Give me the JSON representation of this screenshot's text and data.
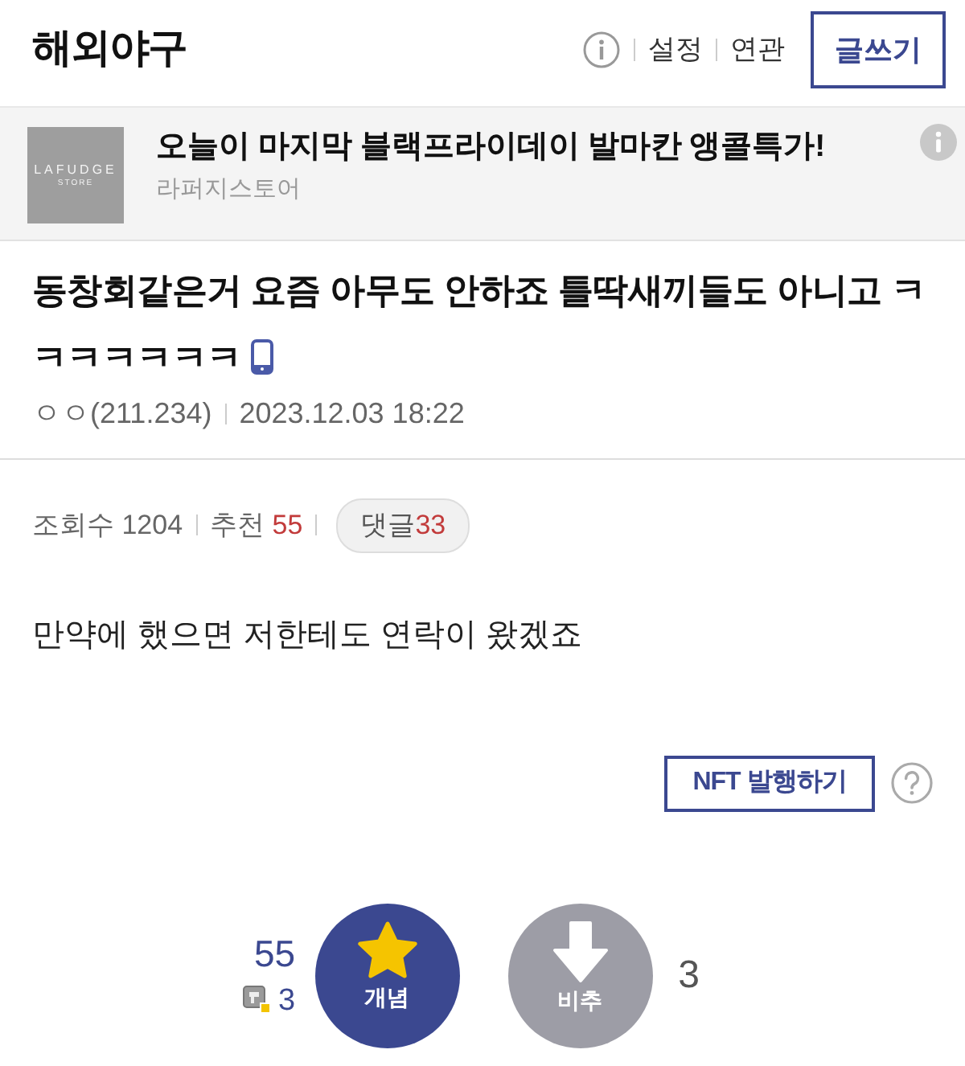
{
  "header": {
    "title": "해외야구",
    "links": [
      "설정",
      "연관"
    ],
    "write_button": "글쓰기"
  },
  "ad": {
    "logo": {
      "name": "LAFUDGE",
      "sub": "STORE"
    },
    "title": "오늘이 마지막 블랙프라이데이 발마칸 앵콜특가!",
    "advertiser": "라퍼지스토어"
  },
  "post": {
    "title": "동창회같은거 요즘 아무도 안하죠 틀딱새끼들도 아니고 ㅋㅋㅋㅋㅋㅋㅋ",
    "mobile": true,
    "author": "ㅇㅇ(211.234)",
    "date": "2023.12.03 18:22",
    "stats": {
      "views_label": "조회수",
      "views": "1204",
      "recommend_label": "추천",
      "recommend": "55",
      "comments_label": "댓글",
      "comments": "33"
    },
    "body": "만약에 했으면 저한테도 연락이 왔겠죠",
    "nft_button": "NFT 발행하기"
  },
  "votes": {
    "up_count": "55",
    "fixed_count": "3",
    "up_label": "개념",
    "down_label": "비추",
    "down_count": "3"
  }
}
